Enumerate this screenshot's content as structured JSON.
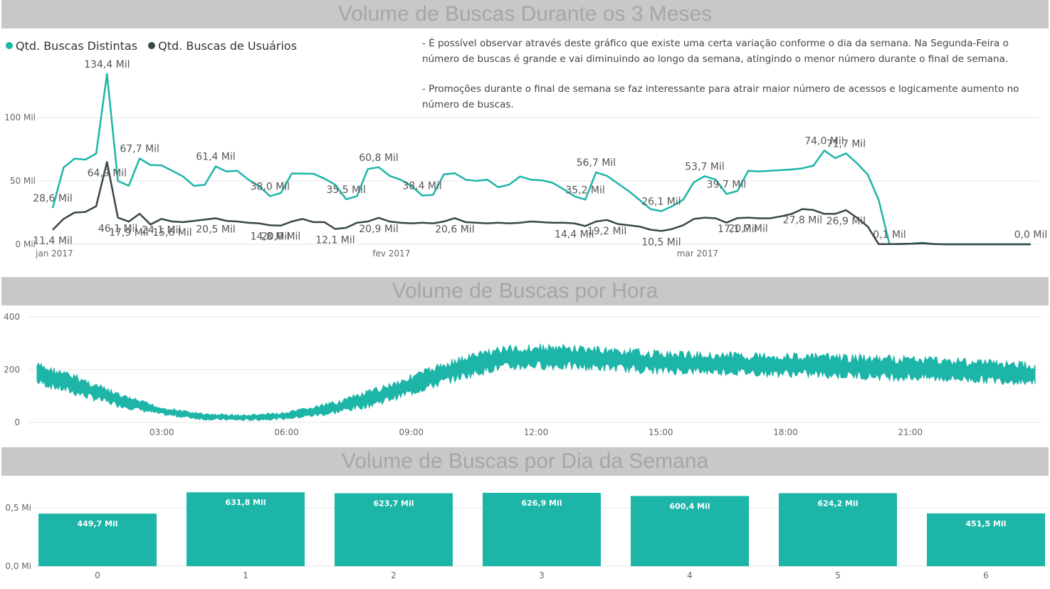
{
  "colors": {
    "teal": "#1db5a8",
    "dark": "#37474a",
    "band": "#c8c8c8",
    "title": "#a6a6a6"
  },
  "titles": {
    "t1": "Volume de Buscas Durante os 3 Meses",
    "t2": "Volume de Buscas por Hora",
    "t3": "Volume de Buscas por Dia da Semana"
  },
  "legend": {
    "s1": "Qtd. Buscas Distintas",
    "s2": "Qtd. Buscas de Usuários"
  },
  "notes": [
    "- É possível observar através deste gráfico que existe uma certa variação conforme o dia da semana. Na Segunda-Feira o número de buscas é grande e vai diminuindo ao longo da semana, atingindo o menor número durante o final de semana.",
    "- Promoções durante o final de semana se faz interessante para atrair maior número de acessos e logicamente aumento no número de buscas."
  ],
  "chart_data": [
    {
      "type": "line",
      "title": "Volume de Buscas Durante os 3 Meses",
      "y_ticks": [
        "0 Mil",
        "50 Mil",
        "100 Mil"
      ],
      "ylim": [
        0,
        100000
      ],
      "x_ticks": [
        {
          "day": 1,
          "label": "jan 2017"
        },
        {
          "day": 32,
          "label": "fev 2017"
        },
        {
          "day": 60,
          "label": "mar 2017"
        }
      ],
      "x_day_range": [
        1,
        91
      ],
      "series": [
        {
          "name": "Qtd. Buscas Distintas",
          "color": "#1db5a8",
          "values": [
            28600,
            60500,
            67500,
            66800,
            71500,
            134400,
            50000,
            46100,
            67700,
            62500,
            62300,
            58000,
            53500,
            46100,
            46900,
            61400,
            57500,
            58000,
            51000,
            45800,
            38000,
            40500,
            55900,
            55800,
            55600,
            51800,
            47000,
            35500,
            38000,
            59400,
            60800,
            54000,
            51000,
            46000,
            38400,
            39000,
            55200,
            56000,
            51000,
            50000,
            51000,
            45000,
            47000,
            53500,
            51000,
            50500,
            48500,
            43500,
            38000,
            35200,
            56700,
            54000,
            48000,
            42000,
            35000,
            27800,
            26100,
            30000,
            35000,
            49000,
            53700,
            51000,
            39700,
            42000,
            58000,
            57500,
            58000,
            58500,
            59000,
            60000,
            62000,
            74000,
            68000,
            71700,
            64000,
            55000,
            35000,
            100,
            300,
            500,
            1200,
            300,
            0,
            0,
            0,
            0,
            0,
            0,
            0,
            0,
            0
          ],
          "labels": [
            {
              "day": 1,
              "text": "28,6 Mil"
            },
            {
              "day": 6,
              "text": "134,4 Mil"
            },
            {
              "day": 9,
              "text": "67,7 Mil"
            },
            {
              "day": 16,
              "text": "61,4 Mil"
            },
            {
              "day": 21,
              "text": "38,0 Mil"
            },
            {
              "day": 28,
              "text": "35,5 Mil"
            },
            {
              "day": 31,
              "text": "60,8 Mil"
            },
            {
              "day": 35,
              "text": "38,4 Mil"
            },
            {
              "day": 50,
              "text": "35,2 Mil"
            },
            {
              "day": 51,
              "text": "56,7 Mil"
            },
            {
              "day": 57,
              "text": "26,1 Mil"
            },
            {
              "day": 61,
              "text": "53,7 Mil"
            },
            {
              "day": 63,
              "text": "39,7 Mil"
            },
            {
              "day": 72,
              "text": "74,0 Mil"
            },
            {
              "day": 74,
              "text": "71,7 Mil"
            },
            {
              "day": 78,
              "text": "0,1 Mil"
            },
            {
              "day": 91,
              "text": "0,0 Mil"
            }
          ]
        },
        {
          "name": "Qtd. Buscas de Usuários",
          "color": "#37474a",
          "values": [
            11400,
            20000,
            25000,
            25500,
            30000,
            64900,
            21000,
            17900,
            24100,
            15600,
            20000,
            18000,
            17500,
            18500,
            19500,
            20500,
            18500,
            18000,
            17000,
            16500,
            15000,
            14800,
            18000,
            20000,
            17500,
            17500,
            12100,
            13000,
            17000,
            18000,
            20900,
            18000,
            17000,
            16500,
            17000,
            16500,
            18000,
            20600,
            17500,
            17000,
            16500,
            17000,
            16500,
            17000,
            18000,
            17500,
            17000,
            17000,
            16500,
            14400,
            18000,
            19200,
            16000,
            15000,
            14000,
            11500,
            10500,
            12000,
            15000,
            20000,
            21000,
            20500,
            17100,
            20700,
            21000,
            20500,
            20500,
            22000,
            24000,
            27800,
            27000,
            24000,
            24000,
            26900,
            21000,
            14000,
            100,
            100,
            200,
            400,
            800,
            200,
            0,
            0,
            0,
            0,
            0,
            0,
            0,
            0,
            0
          ],
          "labels": [
            {
              "day": 1,
              "text": "11,4 Mil"
            },
            {
              "day": 6,
              "text": "64,9 Mil"
            },
            {
              "day": 7,
              "text": "46,1 Mil"
            },
            {
              "day": 8,
              "text": "17,9 Mil"
            },
            {
              "day": 11,
              "text": "24,1 Mil"
            },
            {
              "day": 12,
              "text": "15,6 Mil"
            },
            {
              "day": 16,
              "text": "20,5 Mil"
            },
            {
              "day": 22,
              "text": "20,0 Mil"
            },
            {
              "day": 21,
              "text": "14,8 Mil"
            },
            {
              "day": 27,
              "text": "12,1 Mil"
            },
            {
              "day": 31,
              "text": "20,9 Mil"
            },
            {
              "day": 38,
              "text": "20,6 Mil"
            },
            {
              "day": 49,
              "text": "14,4 Mil"
            },
            {
              "day": 52,
              "text": "19,2 Mil"
            },
            {
              "day": 57,
              "text": "10,5 Mil"
            },
            {
              "day": 65,
              "text": "20,7 Mil"
            },
            {
              "day": 64,
              "text": "17,1 Mil"
            },
            {
              "day": 70,
              "text": "27,8 Mil"
            },
            {
              "day": 74,
              "text": "26,9 Mil"
            }
          ]
        }
      ]
    },
    {
      "type": "area",
      "title": "Volume de Buscas por Hora",
      "y_ticks": [
        "0",
        "200",
        "400"
      ],
      "ylim": [
        0,
        400
      ],
      "x_ticks": [
        "03:00",
        "06:00",
        "09:00",
        "12:00",
        "15:00",
        "18:00",
        "21:00"
      ],
      "x_tick_hours": [
        3,
        6,
        9,
        12,
        15,
        18,
        21
      ],
      "x_hour_range": [
        0,
        24
      ],
      "color": "#1db5a8",
      "profile_hours": [
        0,
        1,
        2,
        3,
        4,
        5,
        6,
        7,
        8,
        9,
        10,
        11,
        12,
        13,
        14,
        15,
        16,
        17,
        18,
        19,
        20,
        21,
        22,
        23,
        24
      ],
      "profile_low": [
        140,
        95,
        55,
        25,
        8,
        5,
        10,
        25,
        55,
        100,
        150,
        190,
        200,
        195,
        190,
        180,
        180,
        175,
        170,
        165,
        160,
        155,
        150,
        145,
        140
      ],
      "profile_high": [
        230,
        180,
        110,
        60,
        35,
        30,
        40,
        75,
        125,
        185,
        245,
        290,
        300,
        295,
        285,
        275,
        270,
        268,
        265,
        262,
        258,
        255,
        250,
        240,
        230
      ]
    },
    {
      "type": "bar",
      "title": "Volume de Buscas por Dia da Semana",
      "categories": [
        "0",
        "1",
        "2",
        "3",
        "4",
        "5",
        "6"
      ],
      "values": [
        449.7,
        631.8,
        623.7,
        626.9,
        600.4,
        624.2,
        451.5
      ],
      "value_labels": [
        "449,7 Mil",
        "631,8 Mil",
        "623,7 Mil",
        "626,9 Mil",
        "600,4 Mil",
        "624,2 Mil",
        "451,5 Mil"
      ],
      "y_ticks": [
        "0,0 Mi",
        "0,5 Mi"
      ],
      "ylim": [
        0,
        0.7
      ],
      "color": "#1db5a8"
    }
  ]
}
